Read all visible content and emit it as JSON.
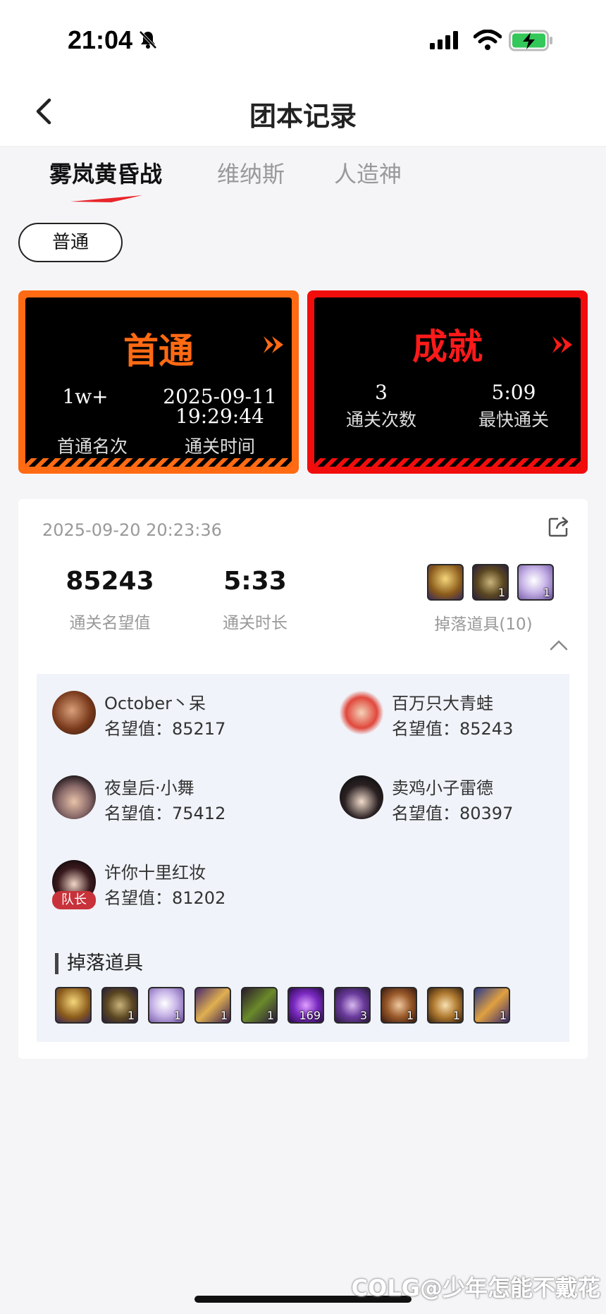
{
  "status_bar": {
    "time": "21:04"
  },
  "header": {
    "title": "团本记录"
  },
  "tabs": [
    {
      "label": "雾岚黄昏战"
    },
    {
      "label": "维纳斯"
    },
    {
      "label": "人造神"
    }
  ],
  "mode_chip": "普通",
  "first_clear_card": {
    "title": "首通",
    "rank_value": "1w+",
    "rank_label": "首通名次",
    "date": "2025-09-11",
    "time": "19:29:44",
    "time_label": "通关时间",
    "color": "#ff6a13"
  },
  "achievement_card": {
    "title": "成就",
    "clears_value": "3",
    "clears_label": "通关次数",
    "fastest_value": "5:09",
    "fastest_label": "最快通关",
    "color": "#f20d0d"
  },
  "record": {
    "datetime": "2025-09-20 20:23:36",
    "fame_value": "85243",
    "fame_label": "通关名望值",
    "duration_value": "5:33",
    "duration_label": "通关时长",
    "drops_label": "掉落道具(10)",
    "preview_items": [
      {
        "icon": "gold-armor-item-icon",
        "count": ""
      },
      {
        "icon": "chest-item-icon",
        "count": "1"
      },
      {
        "icon": "white-swirl-item-icon",
        "count": "1"
      }
    ]
  },
  "party": {
    "members": [
      {
        "name": "October丶呆",
        "fame": "名望值：85217",
        "avatar": "masked-warrior-avatar"
      },
      {
        "name": "百万只大青蛙",
        "fame": "名望值：85243",
        "avatar": "red-hair-avatar"
      },
      {
        "name": "夜皇后·小舞",
        "fame": "名望值：75412",
        "avatar": "silver-hair-avatar"
      },
      {
        "name": "卖鸡小子雷德",
        "fame": "名望值：80397",
        "avatar": "dark-hair-avatar"
      },
      {
        "name": "许你十里红妆",
        "fame": "名望值：81202",
        "avatar": "black-hair-avatar",
        "leader": "队长"
      }
    ],
    "drops_title": "掉落道具",
    "drops": [
      {
        "icon": "gold-armor-item-icon",
        "count": ""
      },
      {
        "icon": "chest-item-icon",
        "count": "1"
      },
      {
        "icon": "white-swirl-item-icon",
        "count": "1"
      },
      {
        "icon": "scroll-item-icon",
        "count": "1"
      },
      {
        "icon": "green-blade-item-icon",
        "count": "1"
      },
      {
        "icon": "purple-crystal-item-icon",
        "count": "169"
      },
      {
        "icon": "purple-orb-item-icon",
        "count": "3"
      },
      {
        "icon": "bronze-orb-item-icon",
        "count": "1"
      },
      {
        "icon": "gold-orb-item-icon",
        "count": "1"
      },
      {
        "icon": "blue-gold-weapon-item-icon",
        "count": "1"
      }
    ]
  },
  "watermark": "COLG@少年怎能不戴花"
}
